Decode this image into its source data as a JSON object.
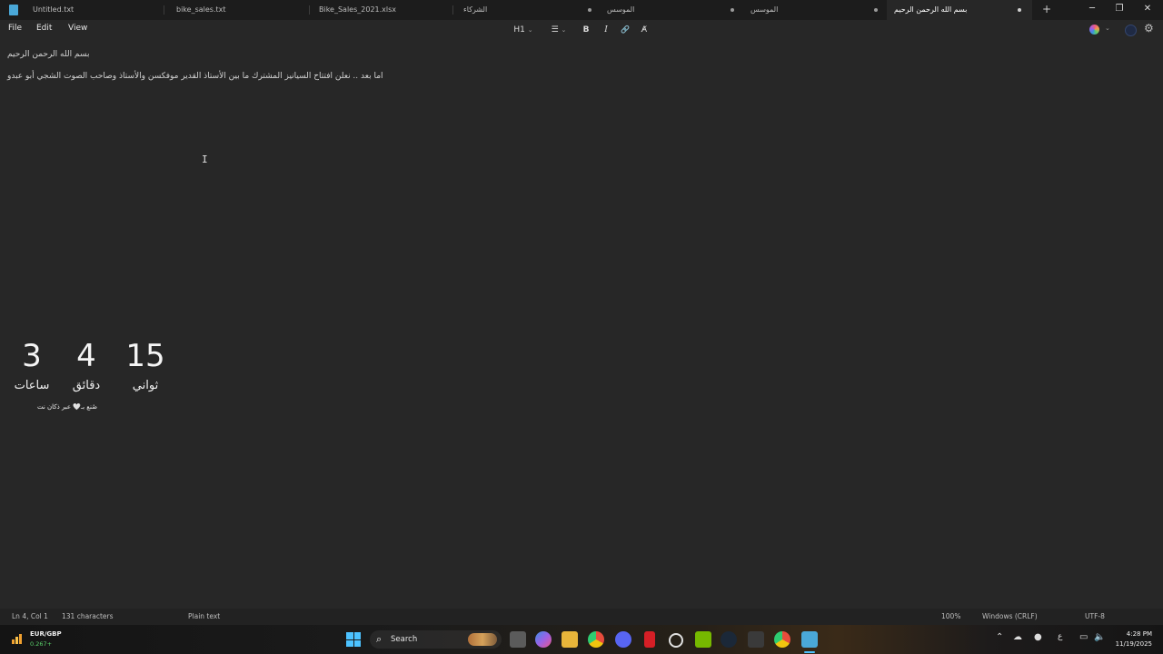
{
  "tabs": [
    {
      "label": "Untitled.txt",
      "active": false
    },
    {
      "label": "bike_sales.txt",
      "active": false
    },
    {
      "label": "Bike_Sales_2021.xlsx",
      "active": false
    },
    {
      "label": "الشركاء",
      "active": false
    },
    {
      "label": "الموسس",
      "active": false,
      "modified": true
    },
    {
      "label": "الموسس",
      "active": false,
      "modified": true
    },
    {
      "label": "بسم الله الرحمن الرحيم",
      "active": true,
      "modified": true
    }
  ],
  "window_controls": {
    "minimize": "─",
    "maximize": "❐",
    "close": "✕"
  },
  "menu": {
    "file": "File",
    "edit": "Edit",
    "view": "View"
  },
  "toolbar": {
    "heading": "H1",
    "list": "☰",
    "bold": "B",
    "italic": "I",
    "link": "🔗",
    "clear_format": "A̸"
  },
  "editor": {
    "lines": [
      "بسم الله الرحمن الرحيم",
      "اما بعد .. نعلن افتتاح السيانيز المشترك ما بين الأستاذ القدير موفكسن والأستاذ وصاحب الصوت الشجي أبو عبدو"
    ]
  },
  "countdown": {
    "hours": "3",
    "hours_label": "ساعات",
    "minutes": "4",
    "minutes_label": "دقائق",
    "seconds": "15",
    "seconds_label": "ثواني",
    "credit": "صُنع بـ🤍 عبر ذكان نت"
  },
  "status": {
    "position": "Ln 4, Col 1",
    "characters": "131 characters",
    "format": "Plain text",
    "zoom": "100%",
    "line_ending": "Windows (CRLF)",
    "encoding": "UTF-8"
  },
  "taskbar": {
    "weather_title": "EUR/GBP",
    "weather_value": "0.267+",
    "search_label": "Search",
    "tray_language": "ع",
    "time": "4:28 PM",
    "date": "11/19/2025",
    "app_icons": [
      "task-view",
      "copilot",
      "file-explorer",
      "chrome",
      "discord",
      "pdf",
      "sync",
      "nvidia",
      "steam",
      "xbox",
      "chrome-2",
      "notepad"
    ]
  },
  "colors": {
    "background": "#272727",
    "accent": "#4cc2ff",
    "text": "#d2d2d2"
  }
}
